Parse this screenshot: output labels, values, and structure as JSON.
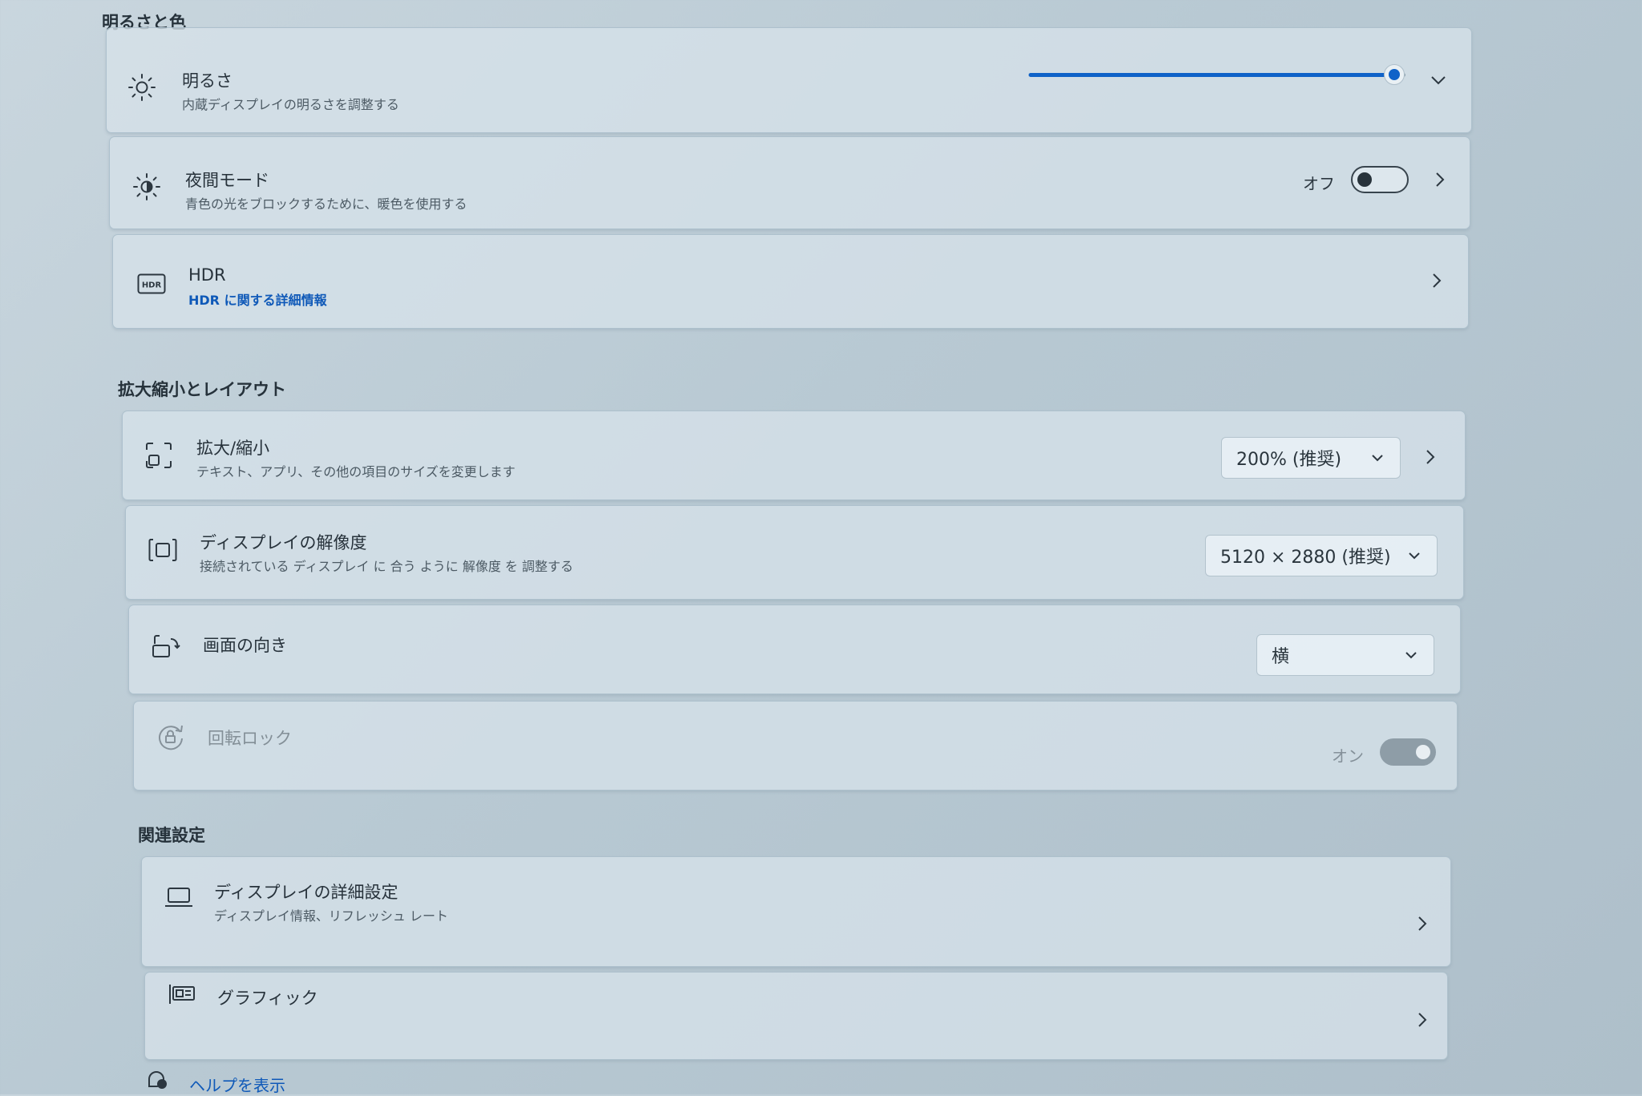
{
  "brightness_section": {
    "title": "明るさと色",
    "brightness": {
      "title": "明るさ",
      "subtitle": "内蔵ディスプレイの明るさを調整する",
      "value_fraction": 0.97
    },
    "night_mode": {
      "title": "夜間モード",
      "subtitle": "青色の光をブロックするために、暖色を使用する",
      "state": "オフ"
    },
    "hdr": {
      "title": "HDR",
      "link": "HDR に関する詳細情報"
    }
  },
  "scale_section": {
    "title": "拡大縮小とレイアウト",
    "scale": {
      "title": "拡大/縮小",
      "subtitle": "テキスト、アプリ、その他の項目のサイズを変更します",
      "value": "200% (推奨)"
    },
    "resolution": {
      "title": "ディスプレイの解像度",
      "subtitle": "接続されている ディスプレイ に 合う ように 解像度 を 調整する",
      "value": "5120 × 2880 (推奨)"
    },
    "orientation": {
      "title": "画面の向き",
      "value": "横"
    },
    "rotation_lock": {
      "title": "回転ロック",
      "state": "オン"
    }
  },
  "related_section": {
    "title": "関連設定",
    "advanced_display": {
      "title": "ディスプレイの詳細設定",
      "subtitle": "ディスプレイ情報、リフレッシュ レート"
    },
    "graphics": {
      "title": "グラフィック"
    }
  },
  "help": {
    "label": "ヘルプを表示"
  },
  "colors": {
    "accent": "#0f62c8",
    "link": "#0f59b8"
  },
  "icons": [
    "sun-icon",
    "night-mode-icon",
    "hdr-icon",
    "scale-icon",
    "resolution-icon",
    "orientation-icon",
    "rotation-lock-icon",
    "laptop-icon",
    "graphics-icon",
    "help-icon"
  ]
}
